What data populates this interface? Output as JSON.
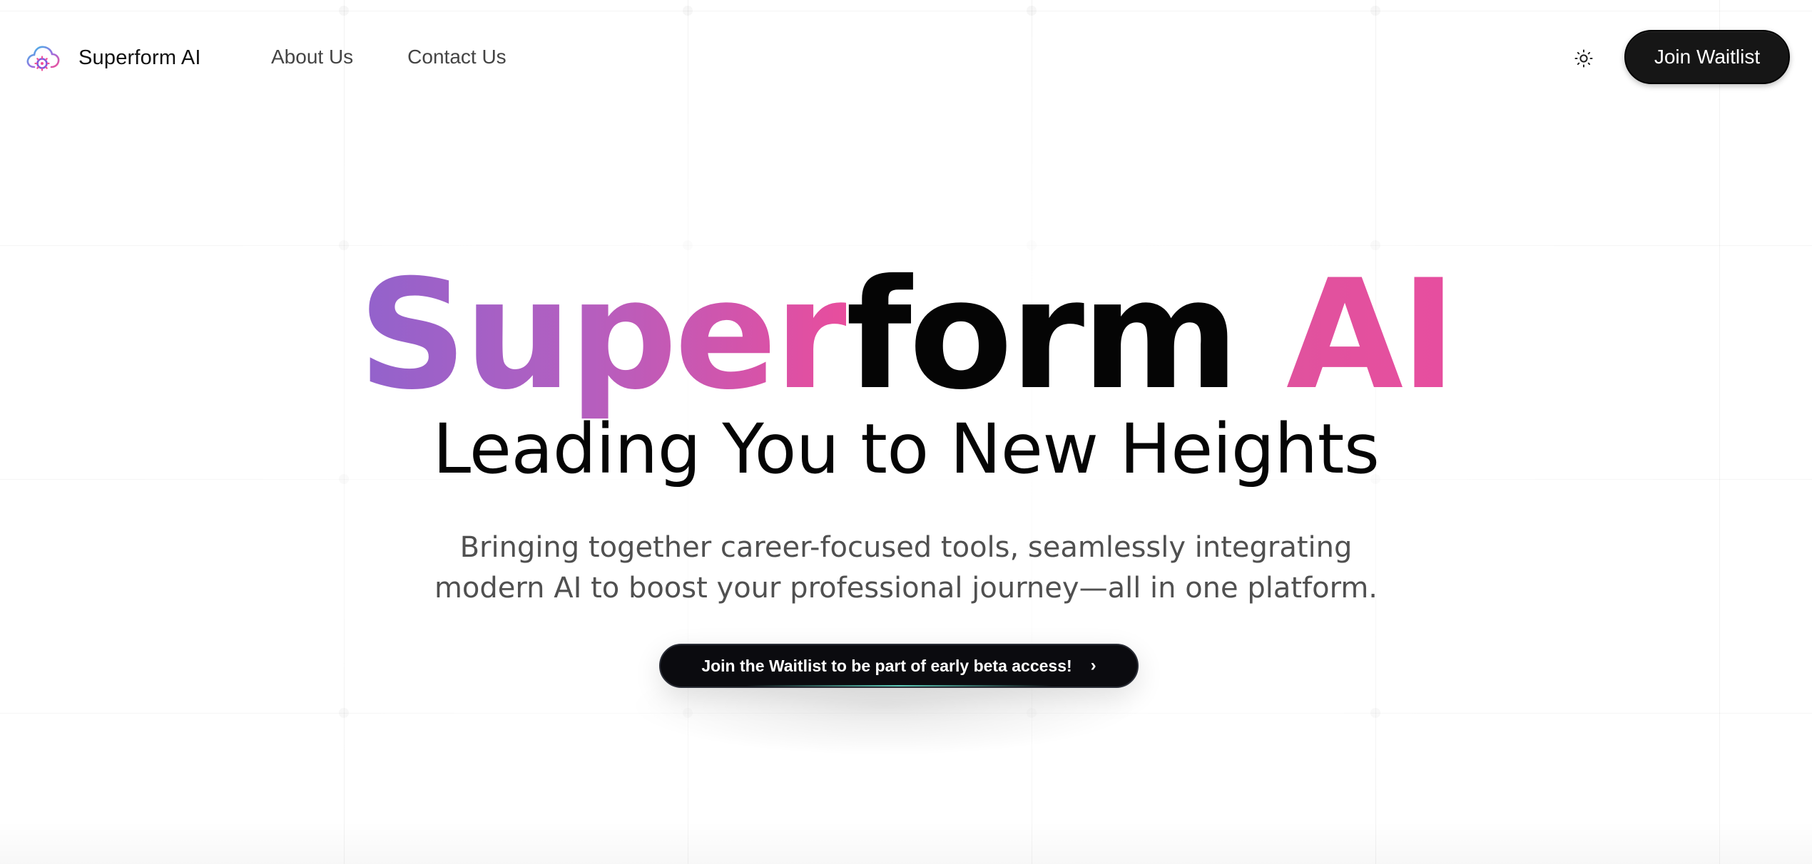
{
  "header": {
    "brand_name": "Superform AI",
    "logo_icon": "cloud-gear-icon",
    "nav": [
      {
        "label": "About Us"
      },
      {
        "label": "Contact Us"
      }
    ],
    "theme_toggle_icon": "sun-icon",
    "join_label": "Join Waitlist"
  },
  "hero": {
    "title_part1": "Super",
    "title_part2": "form",
    "title_part3": "AI",
    "subtitle": "Leading You to New Heights",
    "description": "Bringing together career-focused tools, seamlessly integrating modern AI to boost your professional journey—all in one platform.",
    "cta_label": "Join the Waitlist to be part of early beta access!",
    "cta_icon": "chevron-right-icon"
  },
  "colors": {
    "gradient_start": "#9262cc",
    "gradient_end": "#e84d9d",
    "button_bg": "#161616",
    "text_dark": "#050505",
    "text_muted": "#505050"
  }
}
